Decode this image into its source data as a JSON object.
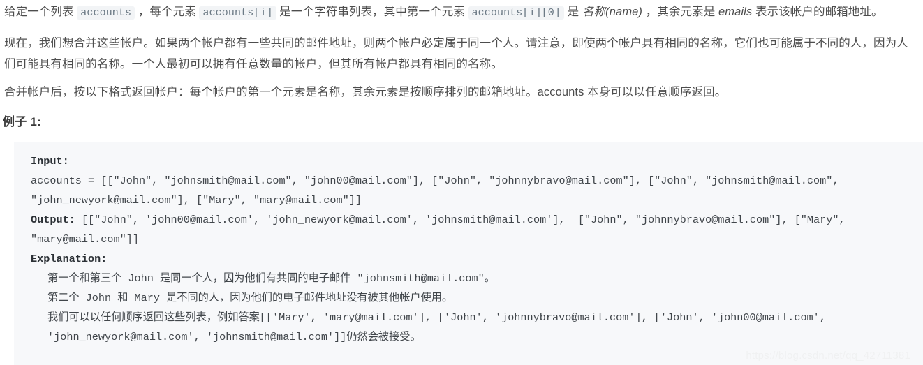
{
  "document": {
    "paragraph_1": {
      "seg_1": "给定一个列表 ",
      "code_1": "accounts",
      "seg_2": " ，每个元素 ",
      "code_2": "accounts[i]",
      "seg_3": " 是一个字符串列表，其中第一个元素 ",
      "code_3": "accounts[i][0]",
      "seg_4": " 是 ",
      "italic_1": "名称(name)",
      "seg_5": " ，其余元素是 ",
      "italic_2": "emails",
      "seg_6": " 表示该帐户的邮箱地址。"
    },
    "paragraph_2": "现在，我们想合并这些帐户。如果两个帐户都有一些共同的邮件地址，则两个帐户必定属于同一个人。请注意，即使两个帐户具有相同的名称，它们也可能属于不同的人，因为人们可能具有相同的名称。一个人最初可以拥有任意数量的帐户，但其所有帐户都具有相同的名称。",
    "paragraph_3": "合并帐户后，按以下格式返回帐户：每个帐户的第一个元素是名称，其余元素是按顺序排列的邮箱地址。accounts 本身可以以任意顺序返回。",
    "example_heading": "例子 1:",
    "code_block": {
      "input_label": "Input:",
      "input_value": "accounts = [[\"John\", \"johnsmith@mail.com\", \"john00@mail.com\"], [\"John\", \"johnnybravo@mail.com\"], [\"John\", \"johnsmith@mail.com\", \"john_newyork@mail.com\"], [\"Mary\", \"mary@mail.com\"]]",
      "output_label": "Output:",
      "output_value": " [[\"John\", 'john00@mail.com', 'john_newyork@mail.com', 'johnsmith@mail.com'],  [\"John\", \"johnnybravo@mail.com\"], [\"Mary\", \"mary@mail.com\"]]",
      "explanation_label": "Explanation:",
      "explanation_line_1": "第一个和第三个 John 是同一个人，因为他们有共同的电子邮件 \"johnsmith@mail.com\"。",
      "explanation_line_2": "第二个 John 和 Mary 是不同的人，因为他们的电子邮件地址没有被其他帐户使用。",
      "explanation_line_3": "我们可以以任何顺序返回这些列表，例如答案[['Mary', 'mary@mail.com'], ['John', 'johnnybravo@mail.com'], ['John', 'john00@mail.com', 'john_newyork@mail.com', 'johnsmith@mail.com']]仍然会被接受。"
    },
    "watermark": "https://blog.csdn.net/qq_42711381"
  },
  "colors": {
    "page_background": "#ffffff",
    "body_text": "#4d4d4d",
    "inline_code_background": "#f2f4f6",
    "inline_code_text": "#6c7a85",
    "code_block_background": "#f7f8fa",
    "code_block_text": "#41464b",
    "watermark_text": "#f0f1f2"
  }
}
